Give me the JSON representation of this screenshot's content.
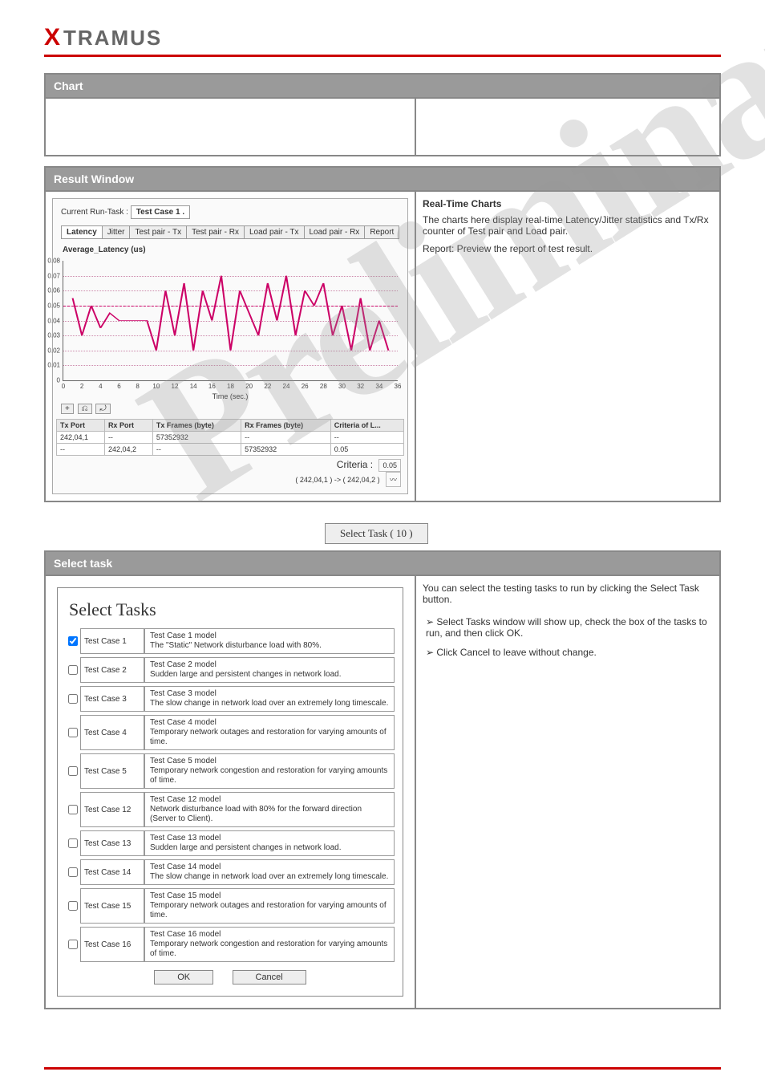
{
  "logo_text": "TRAMUS",
  "watermark": "Preliminary",
  "box1": {
    "header": "Chart"
  },
  "box2": {
    "header": "Result Window",
    "run_task_label": "Current Run-Task :",
    "run_task_value": "Test Case 1 .",
    "tabs": [
      "Latency",
      "Jitter",
      "Test pair - Tx",
      "Test pair - Rx",
      "Load pair - Tx",
      "Load pair - Rx",
      "Report"
    ],
    "active_tab": 0,
    "desc_title": "Real-Time Charts",
    "desc_body": "The charts here display real-time Latency/Jitter statistics and Tx/Rx counter of Test pair and Load pair.",
    "desc_report": "Report: Preview the report of test result."
  },
  "chart_data": {
    "type": "line",
    "title": "Average_Latency (us)",
    "xlabel": "Time (sec.)",
    "ylabel": "",
    "ylim": [
      0,
      0.08
    ],
    "xlim": [
      0,
      36
    ],
    "yticks": [
      0,
      0.01,
      0.02,
      0.03,
      0.04,
      0.05,
      0.06,
      0.07,
      0.08
    ],
    "xticks": [
      0,
      2,
      4,
      6,
      8,
      10,
      12,
      14,
      16,
      18,
      20,
      22,
      24,
      26,
      28,
      30,
      32,
      34,
      36
    ],
    "criteria_line": 0.05,
    "series": [
      {
        "name": "latency",
        "x": [
          1,
          2,
          3,
          4,
          5,
          6,
          7,
          8,
          9,
          10,
          11,
          12,
          13,
          14,
          15,
          16,
          17,
          18,
          19,
          20,
          21,
          22,
          23,
          24,
          25,
          26,
          27,
          28,
          29,
          30,
          31,
          32,
          33,
          34,
          35
        ],
        "y": [
          0.055,
          0.03,
          0.05,
          0.035,
          0.045,
          0.04,
          0.04,
          0.04,
          0.04,
          0.02,
          0.06,
          0.03,
          0.065,
          0.02,
          0.06,
          0.04,
          0.07,
          0.02,
          0.06,
          0.045,
          0.03,
          0.065,
          0.04,
          0.07,
          0.03,
          0.06,
          0.05,
          0.065,
          0.03,
          0.05,
          0.02,
          0.055,
          0.02,
          0.04,
          0.02
        ]
      }
    ]
  },
  "zoom": {
    "in": "+",
    "reset": "⎌",
    "out": "⤾"
  },
  "port_table": {
    "headers": [
      "Tx Port",
      "Rx Port",
      "Tx Frames (byte)",
      "Rx Frames (byte)",
      "Criteria of L..."
    ],
    "rows": [
      [
        "242,04,1",
        "--",
        "57352932",
        "--",
        "--"
      ],
      [
        "--",
        "242,04,2",
        "--",
        "57352932",
        "0.05"
      ]
    ],
    "criteria_label": "Criteria :",
    "criteria_value": "0.05",
    "mapping": "( 242,04,1 ) -> ( 242,04,2 )"
  },
  "select_task_btn": "Select Task ( 10 )",
  "box3": {
    "header": "Select task",
    "dlg_title": "Select Tasks",
    "tasks": [
      {
        "checked": true,
        "label": "Test Case 1",
        "name": "Test Case 1 model",
        "desc": "The \"Static\" Network disturbance load with 80%."
      },
      {
        "checked": false,
        "label": "Test Case 2",
        "name": "Test Case 2 model",
        "desc": "Sudden large and persistent changes in network load."
      },
      {
        "checked": false,
        "label": "Test Case 3",
        "name": "Test Case 3 model",
        "desc": "The slow change in network load over an extremely long timescale."
      },
      {
        "checked": false,
        "label": "Test Case 4",
        "name": "Test Case 4 model",
        "desc": "Temporary network outages and restoration for varying amounts of time."
      },
      {
        "checked": false,
        "label": "Test Case 5",
        "name": "Test Case 5 model",
        "desc": "Temporary network congestion and restoration for varying amounts of time."
      },
      {
        "checked": false,
        "label": "Test Case 12",
        "name": "Test Case 12 model",
        "desc": "Network disturbance load with 80% for the forward direction (Server to Client)."
      },
      {
        "checked": false,
        "label": "Test Case 13",
        "name": "Test Case 13 model",
        "desc": "Sudden large and persistent changes in network load."
      },
      {
        "checked": false,
        "label": "Test Case 14",
        "name": "Test Case 14 model",
        "desc": "The slow change in network load over an extremely long timescale."
      },
      {
        "checked": false,
        "label": "Test Case 15",
        "name": "Test Case 15 model",
        "desc": "Temporary network outages and restoration for varying amounts of time."
      },
      {
        "checked": false,
        "label": "Test Case 16",
        "name": "Test Case 16 model",
        "desc": "Temporary network congestion and restoration for varying amounts of time."
      }
    ],
    "ok": "OK",
    "cancel": "Cancel",
    "right1": "You can select the testing tasks to run by clicking the Select Task button.",
    "right2a": "Select Tasks window will show up, check the box of the tasks to run, and then click OK.",
    "right2b": "Click Cancel to leave without change."
  }
}
